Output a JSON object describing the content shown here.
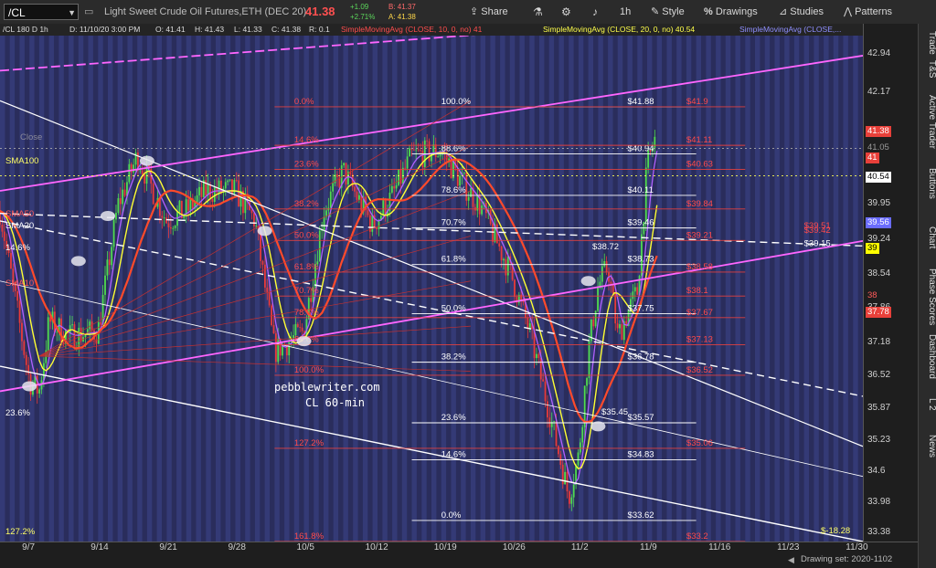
{
  "toolbar": {
    "symbol": "/CL",
    "description": "Light Sweet Crude Oil Futures,ETH (DEC 20)",
    "last": "41.38",
    "change": "+1.09",
    "change_pct": "+2.71%",
    "bid": "B: 41.37",
    "ask": "A: 41.38",
    "share_label": "Share",
    "period": "1h",
    "style_label": "Style",
    "drawings_label": "Drawings",
    "studies_label": "Studies",
    "patterns_label": "Patterns"
  },
  "info": {
    "symbol_period": "/CL 180 D 1h",
    "date": "D: 11/10/20 3:00 PM",
    "open": "O: 41.41",
    "high": "H: 41.43",
    "low": "L: 41.33",
    "close": "C: 41.38",
    "range": "R: 0.1",
    "sma10": "SimpleMovingAvg (CLOSE, 10, 0, no) 41",
    "sma20": "SimpleMovingAvg (CLOSE, 20, 0, no) 40.54",
    "sma50": "SimpleMovingAvg (CLOSE,..."
  },
  "side_tabs": [
    "Trade",
    "T&S",
    "Active Trader",
    "Buttons",
    "Chart",
    "Phase Scores",
    "Dashboard",
    "L 2",
    "News"
  ],
  "status": {
    "drawing_set": "Drawing set: 2020-1102"
  },
  "overlays": {
    "watermark_line1": "pebblewriter.com",
    "watermark_line2": "CL 60-min",
    "sma100": "SMA100",
    "sma50": "SMA50",
    "sma20": "SMA20",
    "sma10": "SMA10",
    "close": "Close",
    "left_146": "14.6%",
    "left_236": "23.6%",
    "left_1272": "127.2%",
    "note_3872": "$38.72",
    "note_3545": "$35.45",
    "note_1828": "$-18.28"
  },
  "price_tags": [
    {
      "text": "41.05",
      "value": 41.05,
      "fg": "#9a9a9a",
      "bg": ""
    },
    {
      "text": "41",
      "value": 40.85,
      "fg": "#ffffff",
      "bg": "#e8403a"
    },
    {
      "text": "41.38",
      "value": 41.38,
      "fg": "#ffffff",
      "bg": "#e8403a"
    },
    {
      "text": "40.5",
      "value": 40.5,
      "fg": "#ffff00",
      "bg": ""
    },
    {
      "text": "40.54",
      "value": 40.47,
      "fg": "#000000",
      "bg": "#ffffff"
    },
    {
      "text": "39.56",
      "value": 39.56,
      "fg": "#ffffff",
      "bg": "#6a6cff"
    },
    {
      "text": "39",
      "value": 39.05,
      "fg": "#000000",
      "bg": "#ffff00"
    },
    {
      "text": "38",
      "value": 38.1,
      "fg": "#ff5a5a",
      "bg": ""
    },
    {
      "text": "37.78",
      "value": 37.78,
      "fg": "#ffffff",
      "bg": "#e8403a"
    }
  ],
  "chart_data": {
    "type": "candlestick",
    "ylim": [
      33.2,
      43.3
    ],
    "yticks": [
      42.94,
      42.17,
      41.48,
      40.79,
      40.1,
      39.95,
      39.24,
      38.54,
      37.86,
      37.18,
      36.52,
      35.87,
      35.23,
      34.6,
      33.98,
      33.38
    ],
    "ytick_labels": [
      "42.94",
      "42.17",
      "",
      "",
      "",
      "39.95",
      "39.24",
      "38.54",
      "37.86",
      "37.18",
      "36.52",
      "35.87",
      "35.23",
      "34.6",
      "33.98",
      "33.38"
    ],
    "xlim": [
      "2020-09-04",
      "2020-12-01"
    ],
    "date_ticks": [
      {
        "label": "9/7",
        "date": "2020-09-07"
      },
      {
        "label": "9/14",
        "date": "2020-09-14"
      },
      {
        "label": "9/21",
        "date": "2020-09-21"
      },
      {
        "label": "9/28",
        "date": "2020-09-28"
      },
      {
        "label": "10/5",
        "date": "2020-10-05"
      },
      {
        "label": "10/12",
        "date": "2020-10-12"
      },
      {
        "label": "10/19",
        "date": "2020-10-19"
      },
      {
        "label": "10/26",
        "date": "2020-10-26"
      },
      {
        "label": "11/2",
        "date": "2020-11-02"
      },
      {
        "label": "11/9",
        "date": "2020-11-09"
      },
      {
        "label": "11/16",
        "date": "2020-11-16"
      },
      {
        "label": "11/23",
        "date": "2020-11-23"
      },
      {
        "label": "11/30",
        "date": "2020-11-30"
      }
    ],
    "close_path": [
      {
        "date": "2020-09-04",
        "close": 39.8
      },
      {
        "date": "2020-09-07",
        "close": 36.4
      },
      {
        "date": "2020-09-08",
        "close": 36.2
      },
      {
        "date": "2020-09-09",
        "close": 37.6
      },
      {
        "date": "2020-09-11",
        "close": 37.3
      },
      {
        "date": "2020-09-14",
        "close": 37.4
      },
      {
        "date": "2020-09-16",
        "close": 39.9
      },
      {
        "date": "2020-09-18",
        "close": 40.9
      },
      {
        "date": "2020-09-21",
        "close": 39.6
      },
      {
        "date": "2020-09-23",
        "close": 39.8
      },
      {
        "date": "2020-09-25",
        "close": 40.2
      },
      {
        "date": "2020-09-28",
        "close": 40.2
      },
      {
        "date": "2020-09-30",
        "close": 39.6
      },
      {
        "date": "2020-10-02",
        "close": 37.0
      },
      {
        "date": "2020-10-05",
        "close": 37.4
      },
      {
        "date": "2020-10-07",
        "close": 39.8
      },
      {
        "date": "2020-10-09",
        "close": 40.6
      },
      {
        "date": "2020-10-12",
        "close": 39.5
      },
      {
        "date": "2020-10-14",
        "close": 40.1
      },
      {
        "date": "2020-10-16",
        "close": 40.9
      },
      {
        "date": "2020-10-19",
        "close": 41.0
      },
      {
        "date": "2020-10-21",
        "close": 40.4
      },
      {
        "date": "2020-10-23",
        "close": 39.9
      },
      {
        "date": "2020-10-26",
        "close": 38.6
      },
      {
        "date": "2020-10-28",
        "close": 37.4
      },
      {
        "date": "2020-10-30",
        "close": 35.8
      },
      {
        "date": "2020-11-01",
        "close": 34.1
      },
      {
        "date": "2020-11-02",
        "close": 34.9
      },
      {
        "date": "2020-11-03",
        "close": 37.0
      },
      {
        "date": "2020-11-04",
        "close": 38.3
      },
      {
        "date": "2020-11-05",
        "close": 38.7
      },
      {
        "date": "2020-11-06",
        "close": 37.3
      },
      {
        "date": "2020-11-08",
        "close": 38.2
      },
      {
        "date": "2020-11-09",
        "close": 40.7
      },
      {
        "date": "2020-11-10",
        "close": 41.38
      }
    ],
    "series": [
      {
        "name": "SMA10",
        "color": "#b060ff",
        "values": []
      },
      {
        "name": "SMA20",
        "color": "#ffff33",
        "values": []
      },
      {
        "name": "SMA50",
        "color": "#ff4a2a",
        "values": []
      },
      {
        "name": "SMA100",
        "color": "#ff2a2a",
        "values": []
      }
    ],
    "fib_right": [
      {
        "pct": "100.0%",
        "price": "$41.88",
        "level": 41.88
      },
      {
        "pct": "88.6%",
        "price": "$40.94",
        "level": 40.94
      },
      {
        "pct": "78.6%",
        "price": "$40.11",
        "level": 40.11
      },
      {
        "pct": "70.7%",
        "price": "$39.46",
        "level": 39.46
      },
      {
        "pct": "61.8%",
        "price": "$38.73",
        "level": 38.73
      },
      {
        "pct": "50.0%",
        "price": "$37.75",
        "level": 37.75
      },
      {
        "pct": "38.2%",
        "price": "$36.78",
        "level": 36.78
      },
      {
        "pct": "23.6%",
        "price": "$35.57",
        "level": 35.57
      },
      {
        "pct": "14.6%",
        "price": "$34.83",
        "level": 34.83
      },
      {
        "pct": "0.0%",
        "price": "$33.62",
        "level": 33.62
      }
    ],
    "fib_red": [
      {
        "pct": "0.0%",
        "price": "$41.9",
        "level": 41.88
      },
      {
        "pct": "14.6%",
        "price": "$41.11",
        "level": 41.11
      },
      {
        "pct": "23.6%",
        "price": "$40.63",
        "level": 40.63
      },
      {
        "pct": "38.2%",
        "price": "$39.84",
        "level": 39.84
      },
      {
        "pct": "50.0%",
        "price": "$39.21",
        "level": 39.21
      },
      {
        "pct": "61.8%",
        "price": "$38.58",
        "level": 38.58
      },
      {
        "pct": "70.7%",
        "price": "$38.1",
        "level": 38.1
      },
      {
        "pct": "78.6%",
        "price": "$37.67",
        "level": 37.67
      },
      {
        "pct": "88.6%",
        "price": "$37.13",
        "level": 37.13
      },
      {
        "pct": "100.0%",
        "price": "$36.52",
        "level": 36.52
      },
      {
        "pct": "127.2%",
        "price": "$35.06",
        "level": 35.06
      },
      {
        "pct": "161.8%",
        "price": "$33.2",
        "level": 33.2
      }
    ],
    "extra_right_red": [
      {
        "price": "$39.51",
        "level": 39.51
      },
      {
        "price": "$39.42",
        "level": 39.42
      }
    ],
    "extra_right_white": [
      {
        "price": "$39.15",
        "level": 39.15
      }
    ]
  }
}
